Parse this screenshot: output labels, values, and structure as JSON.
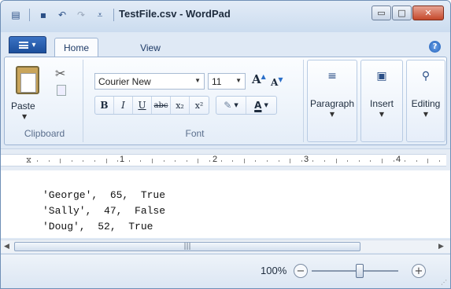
{
  "window": {
    "title": "TestFile.csv - WordPad",
    "controls": {
      "minimize": "▭",
      "maximize": "□",
      "close": "✕"
    }
  },
  "quick_access": {
    "icons": [
      "app-menu-icon",
      "save-icon",
      "undo-icon",
      "redo-icon",
      "customize-icon"
    ]
  },
  "tabs": {
    "file_menu": "▾",
    "home": "Home",
    "view": "View",
    "help": "?"
  },
  "ribbon": {
    "clipboard": {
      "label": "Clipboard",
      "paste": "Paste"
    },
    "font": {
      "label": "Font",
      "family": "Courier New",
      "size": "11",
      "grow": "A",
      "shrink": "A",
      "bold": "B",
      "italic": "I",
      "underline": "U",
      "strike": "abc",
      "subscript": "x₂",
      "superscript": "x²",
      "font_color": "A"
    },
    "paragraph": "Paragraph",
    "insert": "Insert",
    "editing": "Editing"
  },
  "ruler": {
    "marks": [
      "1",
      "2",
      "3",
      "4"
    ]
  },
  "document": {
    "lines": [
      "'George',  65,  True",
      "'Sally',  47,  False",
      "'Doug',  52,  True"
    ]
  },
  "scrollbar": {
    "left_arrow": "◀",
    "right_arrow": "▶",
    "grip": "|||"
  },
  "status": {
    "zoom_level": "100%",
    "zoom_level_fraction": 0.55,
    "zoom_out": "−",
    "zoom_in": "+"
  },
  "colors": {
    "accent": "#1c4f9c",
    "close": "#c4482b",
    "ribbon_bg": "#e4edf8"
  }
}
